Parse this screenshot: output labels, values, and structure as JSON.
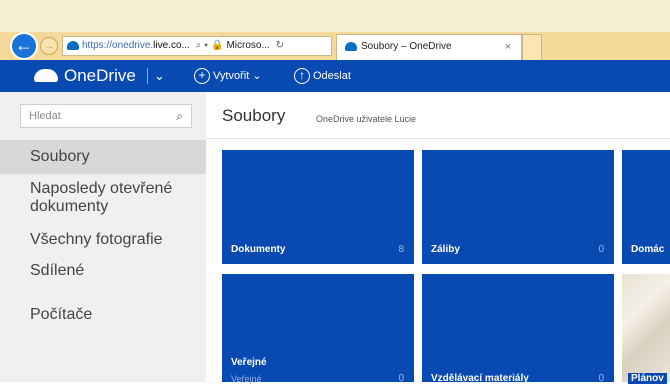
{
  "browser": {
    "address": {
      "url_head": "https://onedrive.",
      "url_domain": "live.co...",
      "search_glyph": "⌕ ▾",
      "secure_label": "🔒 Microso...",
      "refresh_glyph": "↻"
    },
    "tab": {
      "title": "Soubory – OneDrive",
      "close": "×"
    },
    "back_glyph": "←",
    "forward_glyph": "→"
  },
  "appbar": {
    "brand": "OneDrive",
    "chevron": "⌄",
    "create_label": "Vytvořit ⌄",
    "upload_label": "Odeslat"
  },
  "sidebar": {
    "search_placeholder": "Hledat",
    "items": [
      {
        "label": "Soubory"
      },
      {
        "label": "Naposledy otevřené dokumenty"
      },
      {
        "label": "Všechny fotografie"
      },
      {
        "label": "Sdílené"
      },
      {
        "label": "Počítače"
      }
    ]
  },
  "main": {
    "title": "Soubory",
    "subtitle": "OneDrive uživatele Lucie",
    "tiles": [
      {
        "label": "Dokumenty",
        "count": "8"
      },
      {
        "label": "Záliby",
        "count": "0"
      },
      {
        "label": "Domác"
      },
      {
        "label": "Veřejné",
        "sublabel": "Veřejné",
        "count": "0"
      },
      {
        "label": "Vzdělávací materiály",
        "count": "0"
      },
      {
        "label": "Plánov"
      }
    ]
  },
  "colors": {
    "accent": "#094ab2",
    "sidebar_bg": "#f0f0f0",
    "active_item": "#d8d8d8"
  }
}
